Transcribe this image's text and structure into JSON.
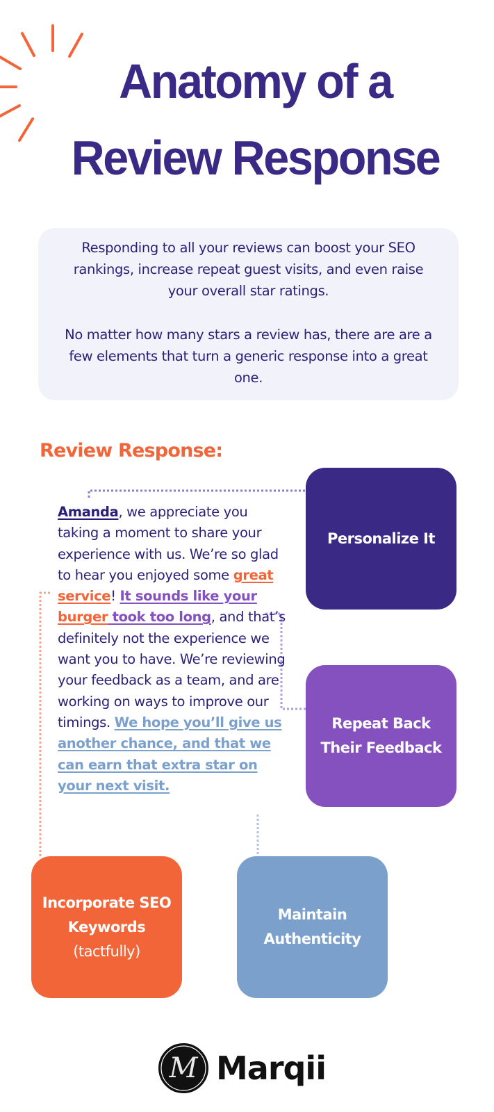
{
  "header": {
    "title_line1": "Anatomy of a",
    "title_line2": "Review Response",
    "decoration": "sunburst-icon"
  },
  "intro": {
    "paragraph1": "Responding to all your reviews can boost your SEO rankings, increase repeat guest visits, and even raise your overall star ratings.",
    "paragraph2": "No matter how many stars a review has, there are are a few elements that turn a generic response into a great one."
  },
  "review": {
    "heading": "Review Response:",
    "segments": {
      "name": "Amanda",
      "t1": ", we appreciate you taking a moment to share your experience with us. We’re so glad to hear you enjoyed some ",
      "seo1": "great service",
      "t2": "! ",
      "fb1": "It sounds like your ",
      "seo2": "burger",
      "fb2": " took too long",
      "t3": ", and that’s definitely not the experience we want you to have. We’re reviewing your feedback as a team, and are working on ways to improve our timings. ",
      "auth": "We hope you’ll give us another chance, and that we can earn that extra star on your next visit."
    }
  },
  "cards": {
    "personalize": {
      "label": "Personalize It",
      "color": "#3b2a85"
    },
    "repeat": {
      "line1": "Repeat Back",
      "line2": "Their Feedback",
      "color": "#8451bf"
    },
    "seo": {
      "line1": "Incorporate SEO",
      "line2": "Keywords",
      "line3": "(tactfully)",
      "color": "#f26539"
    },
    "authenticity": {
      "line1": "Maintain",
      "line2": "Authenticity",
      "color": "#7ba0cc"
    }
  },
  "footer": {
    "logo_text": "Marqii",
    "logo_mark": "M"
  },
  "colors": {
    "primary": "#3b2a85",
    "accent_orange": "#f26539",
    "accent_purple": "#8451bf",
    "accent_blue": "#7ba0cc",
    "card_bg": "#f2f3fa"
  }
}
